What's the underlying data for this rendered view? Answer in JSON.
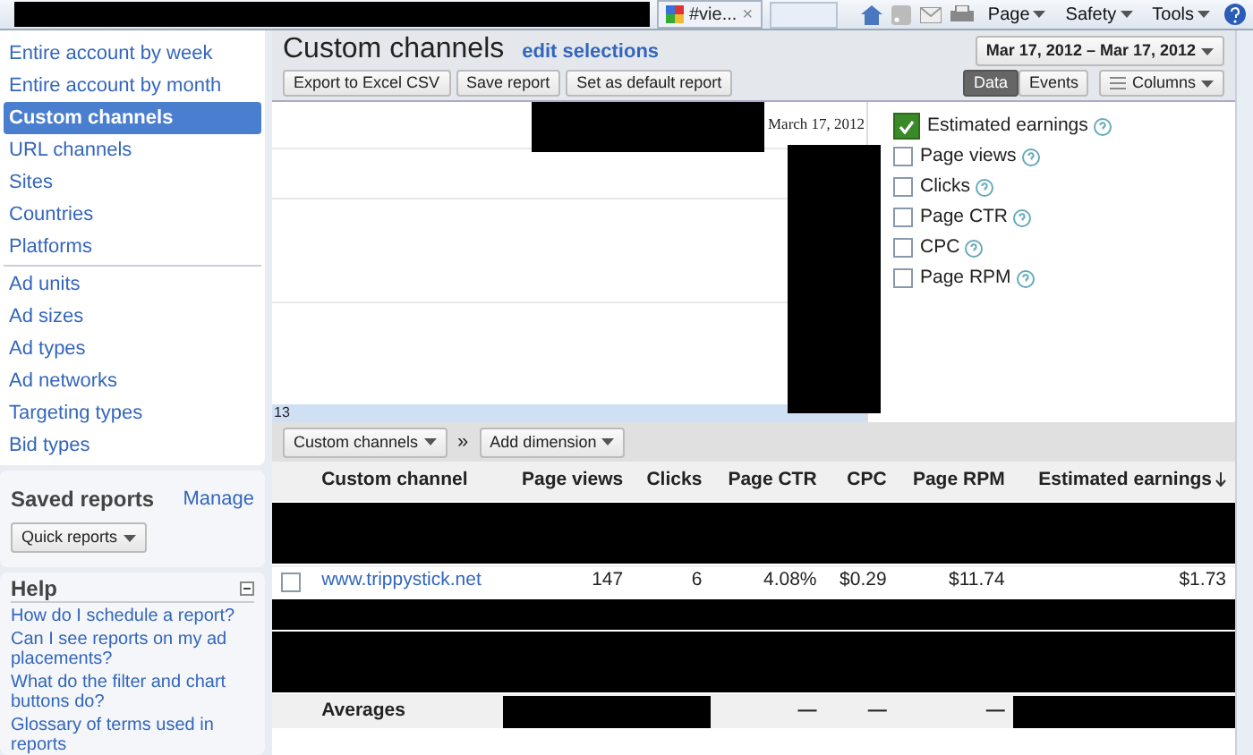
{
  "browser_bar": {
    "tab_title": "#vie...",
    "tab_close": "×",
    "menus": [
      {
        "label": "Page"
      },
      {
        "label": "Safety"
      },
      {
        "label": "Tools"
      }
    ]
  },
  "sidebar": {
    "report_groups": [
      [
        {
          "label": "Entire account by week",
          "selected": false
        },
        {
          "label": "Entire account by month",
          "selected": false
        },
        {
          "label": "Custom channels",
          "selected": true
        },
        {
          "label": "URL channels",
          "selected": false
        },
        {
          "label": "Sites",
          "selected": false
        },
        {
          "label": "Countries",
          "selected": false
        },
        {
          "label": "Platforms",
          "selected": false
        }
      ],
      [
        {
          "label": "Ad units",
          "selected": false
        },
        {
          "label": "Ad sizes",
          "selected": false
        },
        {
          "label": "Ad types",
          "selected": false
        },
        {
          "label": "Ad networks",
          "selected": false
        },
        {
          "label": "Targeting types",
          "selected": false
        },
        {
          "label": "Bid types",
          "selected": false
        }
      ]
    ],
    "saved_reports": {
      "title": "Saved reports",
      "manage": "Manage",
      "quick_reports": "Quick reports"
    },
    "help": {
      "title": "Help",
      "expanded": true,
      "links": [
        "How do I schedule a report?",
        "Can I see reports on my ad placements?",
        "What do the filter and chart buttons do?",
        "Glossary of terms used in reports"
      ]
    }
  },
  "report": {
    "title": "Custom channels",
    "edit_link": "edit selections",
    "date_range": "Mar 17, 2012 – Mar 17, 2012",
    "actions": [
      "Export to Excel CSV",
      "Save report",
      "Set as default report"
    ],
    "view_toggle": [
      {
        "label": "Data",
        "selected": true
      },
      {
        "label": "Events",
        "selected": false
      }
    ],
    "columns_button": "Columns",
    "chart": {
      "date_label": "March 17, 2012",
      "axis_label": "13"
    },
    "metrics": [
      {
        "label": "Estimated earnings",
        "checked": true
      },
      {
        "label": "Page views",
        "checked": false
      },
      {
        "label": "Clicks",
        "checked": false
      },
      {
        "label": "Page CTR",
        "checked": false
      },
      {
        "label": "CPC",
        "checked": false
      },
      {
        "label": "Page RPM",
        "checked": false
      }
    ],
    "dimension_buttons": [
      "Custom channels",
      "Add dimension"
    ],
    "dimension_separator": "»",
    "table": {
      "columns": [
        {
          "label": "Custom channel",
          "sorted": false
        },
        {
          "label": "Page views",
          "sorted": false
        },
        {
          "label": "Clicks",
          "sorted": false
        },
        {
          "label": "Page CTR",
          "sorted": false
        },
        {
          "label": "CPC",
          "sorted": false
        },
        {
          "label": "Page RPM",
          "sorted": false
        },
        {
          "label": "Estimated earnings",
          "sorted": true
        }
      ],
      "rows": [
        {
          "kind": "redacted"
        },
        {
          "kind": "redacted"
        },
        {
          "kind": "data",
          "checked": false,
          "cells": [
            "www.trippystick.net",
            "147",
            "6",
            "4.08%",
            "$0.29",
            "$11.74",
            "$1.73"
          ]
        },
        {
          "kind": "redacted"
        },
        {
          "kind": "redacted"
        },
        {
          "kind": "redacted"
        }
      ],
      "averages": {
        "label": "Averages",
        "cells": [
          null,
          null,
          "—",
          "—",
          "—",
          null
        ]
      }
    }
  }
}
